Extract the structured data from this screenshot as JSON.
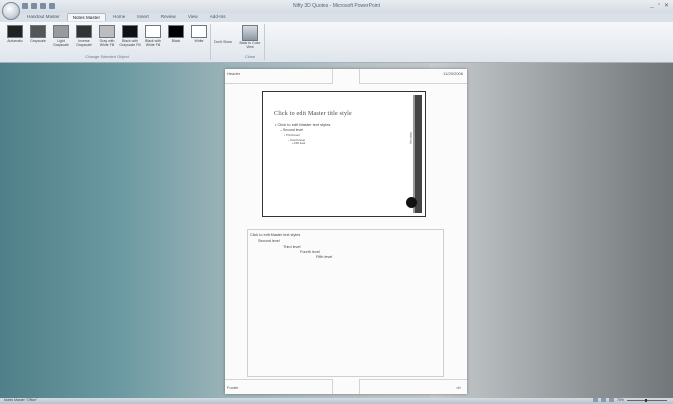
{
  "window": {
    "title": "Nifty 3D Quotes - Microsoft PowerPoint",
    "controls": [
      "_",
      "▫",
      "✕"
    ]
  },
  "quick_access": [
    "save-icon",
    "undo-icon",
    "redo-icon",
    "customize-icon"
  ],
  "tabs": [
    {
      "label": "Handout Master",
      "active": false
    },
    {
      "label": "Notes Master",
      "active": true
    },
    {
      "label": "Home",
      "active": false
    },
    {
      "label": "Insert",
      "active": false
    },
    {
      "label": "Review",
      "active": false
    },
    {
      "label": "View",
      "active": false
    },
    {
      "label": "Add-Ins",
      "active": false
    }
  ],
  "ribbon": {
    "background_styles": [
      {
        "label": "Automatic",
        "swatch": "#222222"
      },
      {
        "label": "Grayscale",
        "swatch": "#555555"
      },
      {
        "label": "Light Grayscale",
        "swatch": "#9a9a9a"
      },
      {
        "label": "Inverse Grayscale",
        "swatch": "#333333"
      },
      {
        "label": "Gray with White Fill",
        "swatch": "#bdbdbd"
      },
      {
        "label": "Black with Grayscale Fill",
        "swatch": "#111111"
      },
      {
        "label": "Black with White Fill",
        "swatch": "#ffffff"
      },
      {
        "label": "Black",
        "swatch": "#000000"
      },
      {
        "label": "White",
        "swatch": "#ffffff"
      }
    ],
    "background_group_label": "Change Selected Object",
    "dont_show_label": "Don't Show",
    "close_button_label": "Back to Color View",
    "close_group_label": "Close"
  },
  "page": {
    "header": "Header",
    "date": "11/20/2006",
    "footer": "Footer",
    "page_number": "‹#›",
    "slide": {
      "title": "Click to edit Master title style",
      "levels": [
        "• Click to edit Master text styles",
        "– Second level",
        "• Third level",
        "– Fourth level",
        "» Fifth level"
      ],
      "vertical_text": "Slide tag"
    },
    "notes": [
      "Click to edit Master text styles",
      "Second level",
      "Third level",
      "Fourth level",
      "Fifth level"
    ]
  },
  "status": {
    "left": "Notes Master   \"Office\"",
    "zoom": "75%"
  }
}
